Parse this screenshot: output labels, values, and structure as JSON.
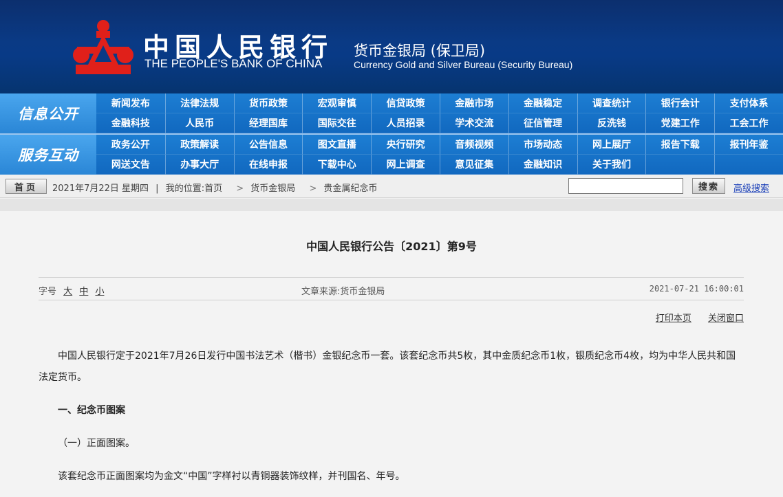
{
  "banner": {
    "bank_name_cn": "中国人民银行",
    "bank_name_en": "THE PEOPLE'S BANK OF CHINA",
    "bureau_cn": "货币金银局 (保卫局)",
    "bureau_en": "Currency  Gold and Silver Bureau (Security Bureau)",
    "logo_icon": "pboc-logo-icon"
  },
  "nav": {
    "info_label": "信息公开",
    "info_items": [
      "新闻发布",
      "法律法规",
      "货币政策",
      "宏观审慎",
      "信贷政策",
      "金融市场",
      "金融稳定",
      "调查统计",
      "银行会计",
      "支付体系",
      "金融科技",
      "人民币",
      "经理国库",
      "国际交往",
      "人员招录",
      "学术交流",
      "征信管理",
      "反洗钱",
      "党建工作",
      "工会工作"
    ],
    "service_label": "服务互动",
    "service_items": [
      "政务公开",
      "政策解读",
      "公告信息",
      "图文直播",
      "央行研究",
      "音频视频",
      "市场动态",
      "网上展厅",
      "报告下载",
      "报刊年鉴",
      "网送文告",
      "办事大厅",
      "在线申报",
      "下载中心",
      "网上调查",
      "意见征集",
      "金融知识",
      "关于我们",
      "",
      ""
    ]
  },
  "breadcrumb": {
    "home_label": "首页",
    "date_text": "2021年7月22日 星期四",
    "location_label": "我的位置:首页",
    "crumb_1": "货币金银局",
    "crumb_2": "贵金属纪念币",
    "separator": ">",
    "divider": "|"
  },
  "search": {
    "input_value": "",
    "button_label": "搜索",
    "advanced_label": "高级搜索"
  },
  "article": {
    "title": "中国人民银行公告〔2021〕第9号",
    "font_size_label": "字号",
    "font_sizes": [
      "大",
      "中",
      "小"
    ],
    "source": "文章来源:货币金银局",
    "datetime": "2021-07-21 16:00:01",
    "print_label": "打印本页",
    "close_label": "关闭窗口",
    "paragraph_1": "中国人民银行定于2021年7月26日发行中国书法艺术（楷书）金银纪念币一套。该套纪念币共5枚，其中金质纪念币1枚，银质纪念币4枚，均为中华人民共和国法定货币。",
    "heading_1": "一、纪念币图案",
    "subheading_1": "（一）正面图案。",
    "paragraph_2": "该套纪念币正面图案均为金文“中国”字样衬以青铜器装饰纹样，并刊国名、年号。"
  },
  "colors": {
    "banner_bg": "#0a3a85",
    "nav_bg": "#1168bf",
    "logo_red": "#e0201a",
    "link_blue": "#1a3fb8"
  }
}
